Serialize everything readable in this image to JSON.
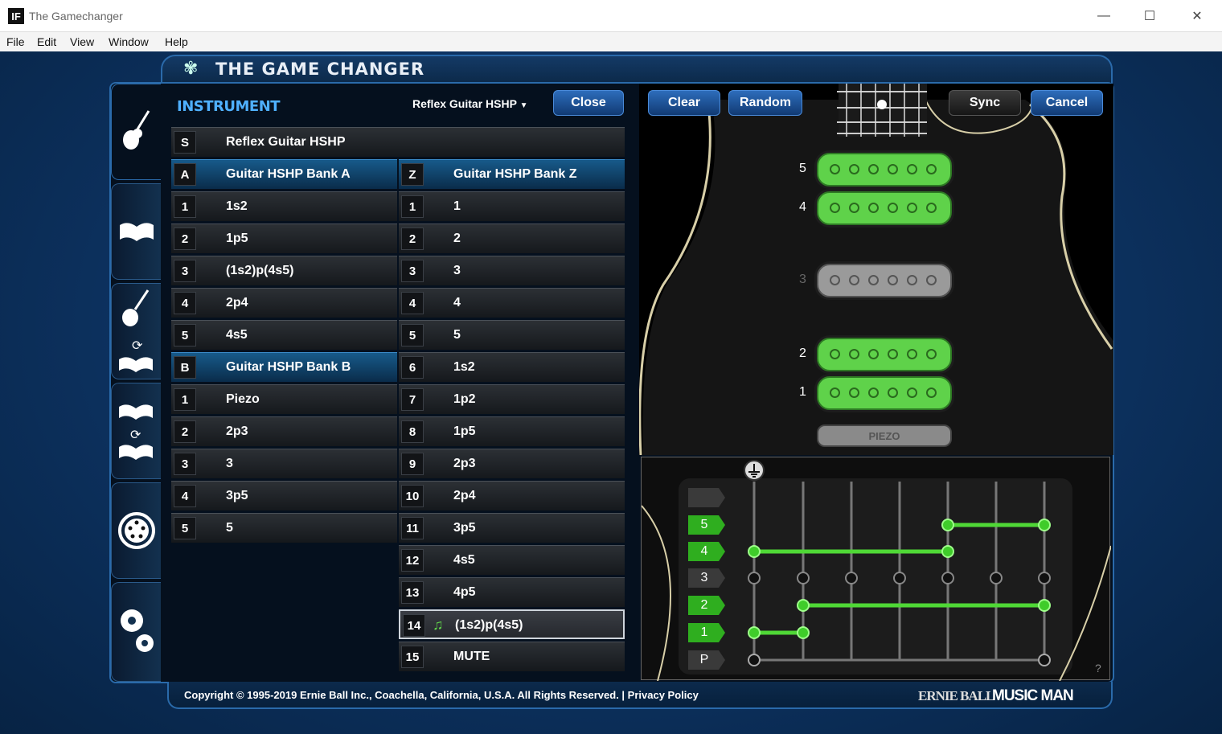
{
  "window": {
    "title": "The Gamechanger",
    "icon": "IF",
    "minimize": "—",
    "maximize": "☐",
    "close": "✕"
  },
  "menu": [
    "File",
    "Edit",
    "View",
    "Window",
    "Help"
  ],
  "header": {
    "title": "THE GAME CHANGER"
  },
  "instrument": {
    "label": "INSTRUMENT",
    "selected": "Reflex Guitar HSHP",
    "close_label": "Close"
  },
  "banks": {
    "s_row": {
      "key": "S",
      "label": "Reflex Guitar HSHP"
    },
    "left": [
      {
        "key": "A",
        "label": "Guitar HSHP Bank A",
        "highlight": true
      },
      {
        "key": "1",
        "label": "1s2"
      },
      {
        "key": "2",
        "label": "1p5"
      },
      {
        "key": "3",
        "label": "(1s2)p(4s5)"
      },
      {
        "key": "4",
        "label": "2p4"
      },
      {
        "key": "5",
        "label": "4s5"
      },
      {
        "key": "B",
        "label": "Guitar HSHP Bank B",
        "highlight": true
      },
      {
        "key": "1",
        "label": "Piezo"
      },
      {
        "key": "2",
        "label": "2p3"
      },
      {
        "key": "3",
        "label": "3"
      },
      {
        "key": "4",
        "label": "3p5"
      },
      {
        "key": "5",
        "label": "5"
      }
    ],
    "right": [
      {
        "key": "Z",
        "label": "Guitar HSHP Bank Z",
        "highlight": true
      },
      {
        "key": "1",
        "label": "1"
      },
      {
        "key": "2",
        "label": "2"
      },
      {
        "key": "3",
        "label": "3"
      },
      {
        "key": "4",
        "label": "4"
      },
      {
        "key": "5",
        "label": "5"
      },
      {
        "key": "6",
        "label": "1s2"
      },
      {
        "key": "7",
        "label": "1p2"
      },
      {
        "key": "8",
        "label": "1p5"
      },
      {
        "key": "9",
        "label": "2p3"
      },
      {
        "key": "10",
        "label": "2p4"
      },
      {
        "key": "11",
        "label": "3p5"
      },
      {
        "key": "12",
        "label": "4s5"
      },
      {
        "key": "13",
        "label": "4p5"
      },
      {
        "key": "14",
        "label": "(1s2)p(4s5)",
        "selected": true
      },
      {
        "key": "15",
        "label": "MUTE"
      }
    ]
  },
  "toolbar": {
    "clear": "Clear",
    "random": "Random",
    "sync": "Sync",
    "cancel": "Cancel"
  },
  "pickups": {
    "labels": {
      "p5": "5",
      "p4": "4",
      "p3": "3",
      "p2": "2",
      "p1": "1"
    },
    "piezo": "PIEZO",
    "active": {
      "p5": true,
      "p4": true,
      "p3": false,
      "p2": true,
      "p1": true
    }
  },
  "matrix": {
    "rows": [
      "",
      "5",
      "4",
      "3",
      "2",
      "1",
      "P"
    ],
    "help": "?"
  },
  "footer": {
    "copyright": "Copyright © 1995-2019 Ernie Ball Inc., Coachella, California, U.S.A. All Rights Reserved. | Privacy Policy",
    "brand1": "ERNIE BALL",
    "brand2": "MUSIC MAN"
  },
  "colors": {
    "accent": "#2d6dbb",
    "pickup_on": "#5fd24a",
    "pickup_off": "#9a9a9a"
  }
}
